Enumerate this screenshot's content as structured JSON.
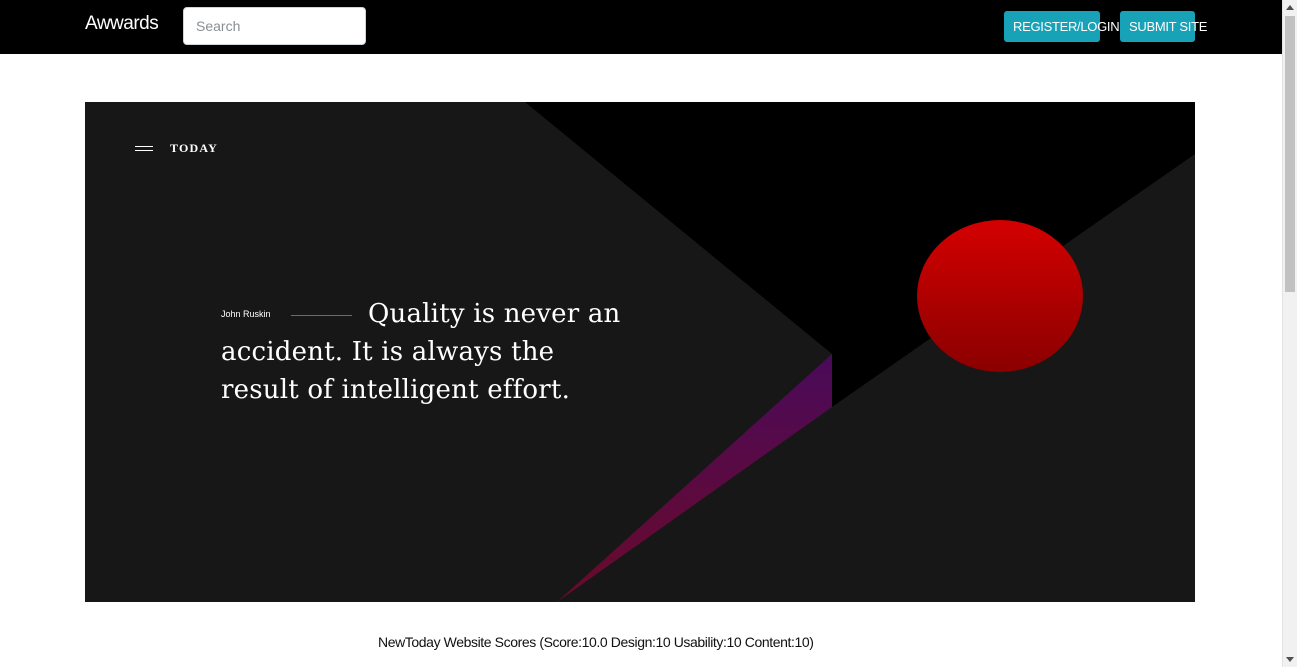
{
  "navbar": {
    "brand": "Awwards",
    "search_placeholder": "Search",
    "register_label": "REGISTER/LOGIN",
    "submit_label": "SUBMIT SITE",
    "button_color": "#17a2b8"
  },
  "hero": {
    "menu_icon": "hamburger-icon",
    "section_label": "TODAY",
    "author": "John Ruskin",
    "quote": "Quality is never an accident. It is always the result of intelligent effort.",
    "accent_color": "#cc0000",
    "stripe_color": "#4a0a5a"
  },
  "site": {
    "scores_text": "NewToday Website Scores (Score:10.0 Design:10 Usability:10 Content:10)"
  }
}
